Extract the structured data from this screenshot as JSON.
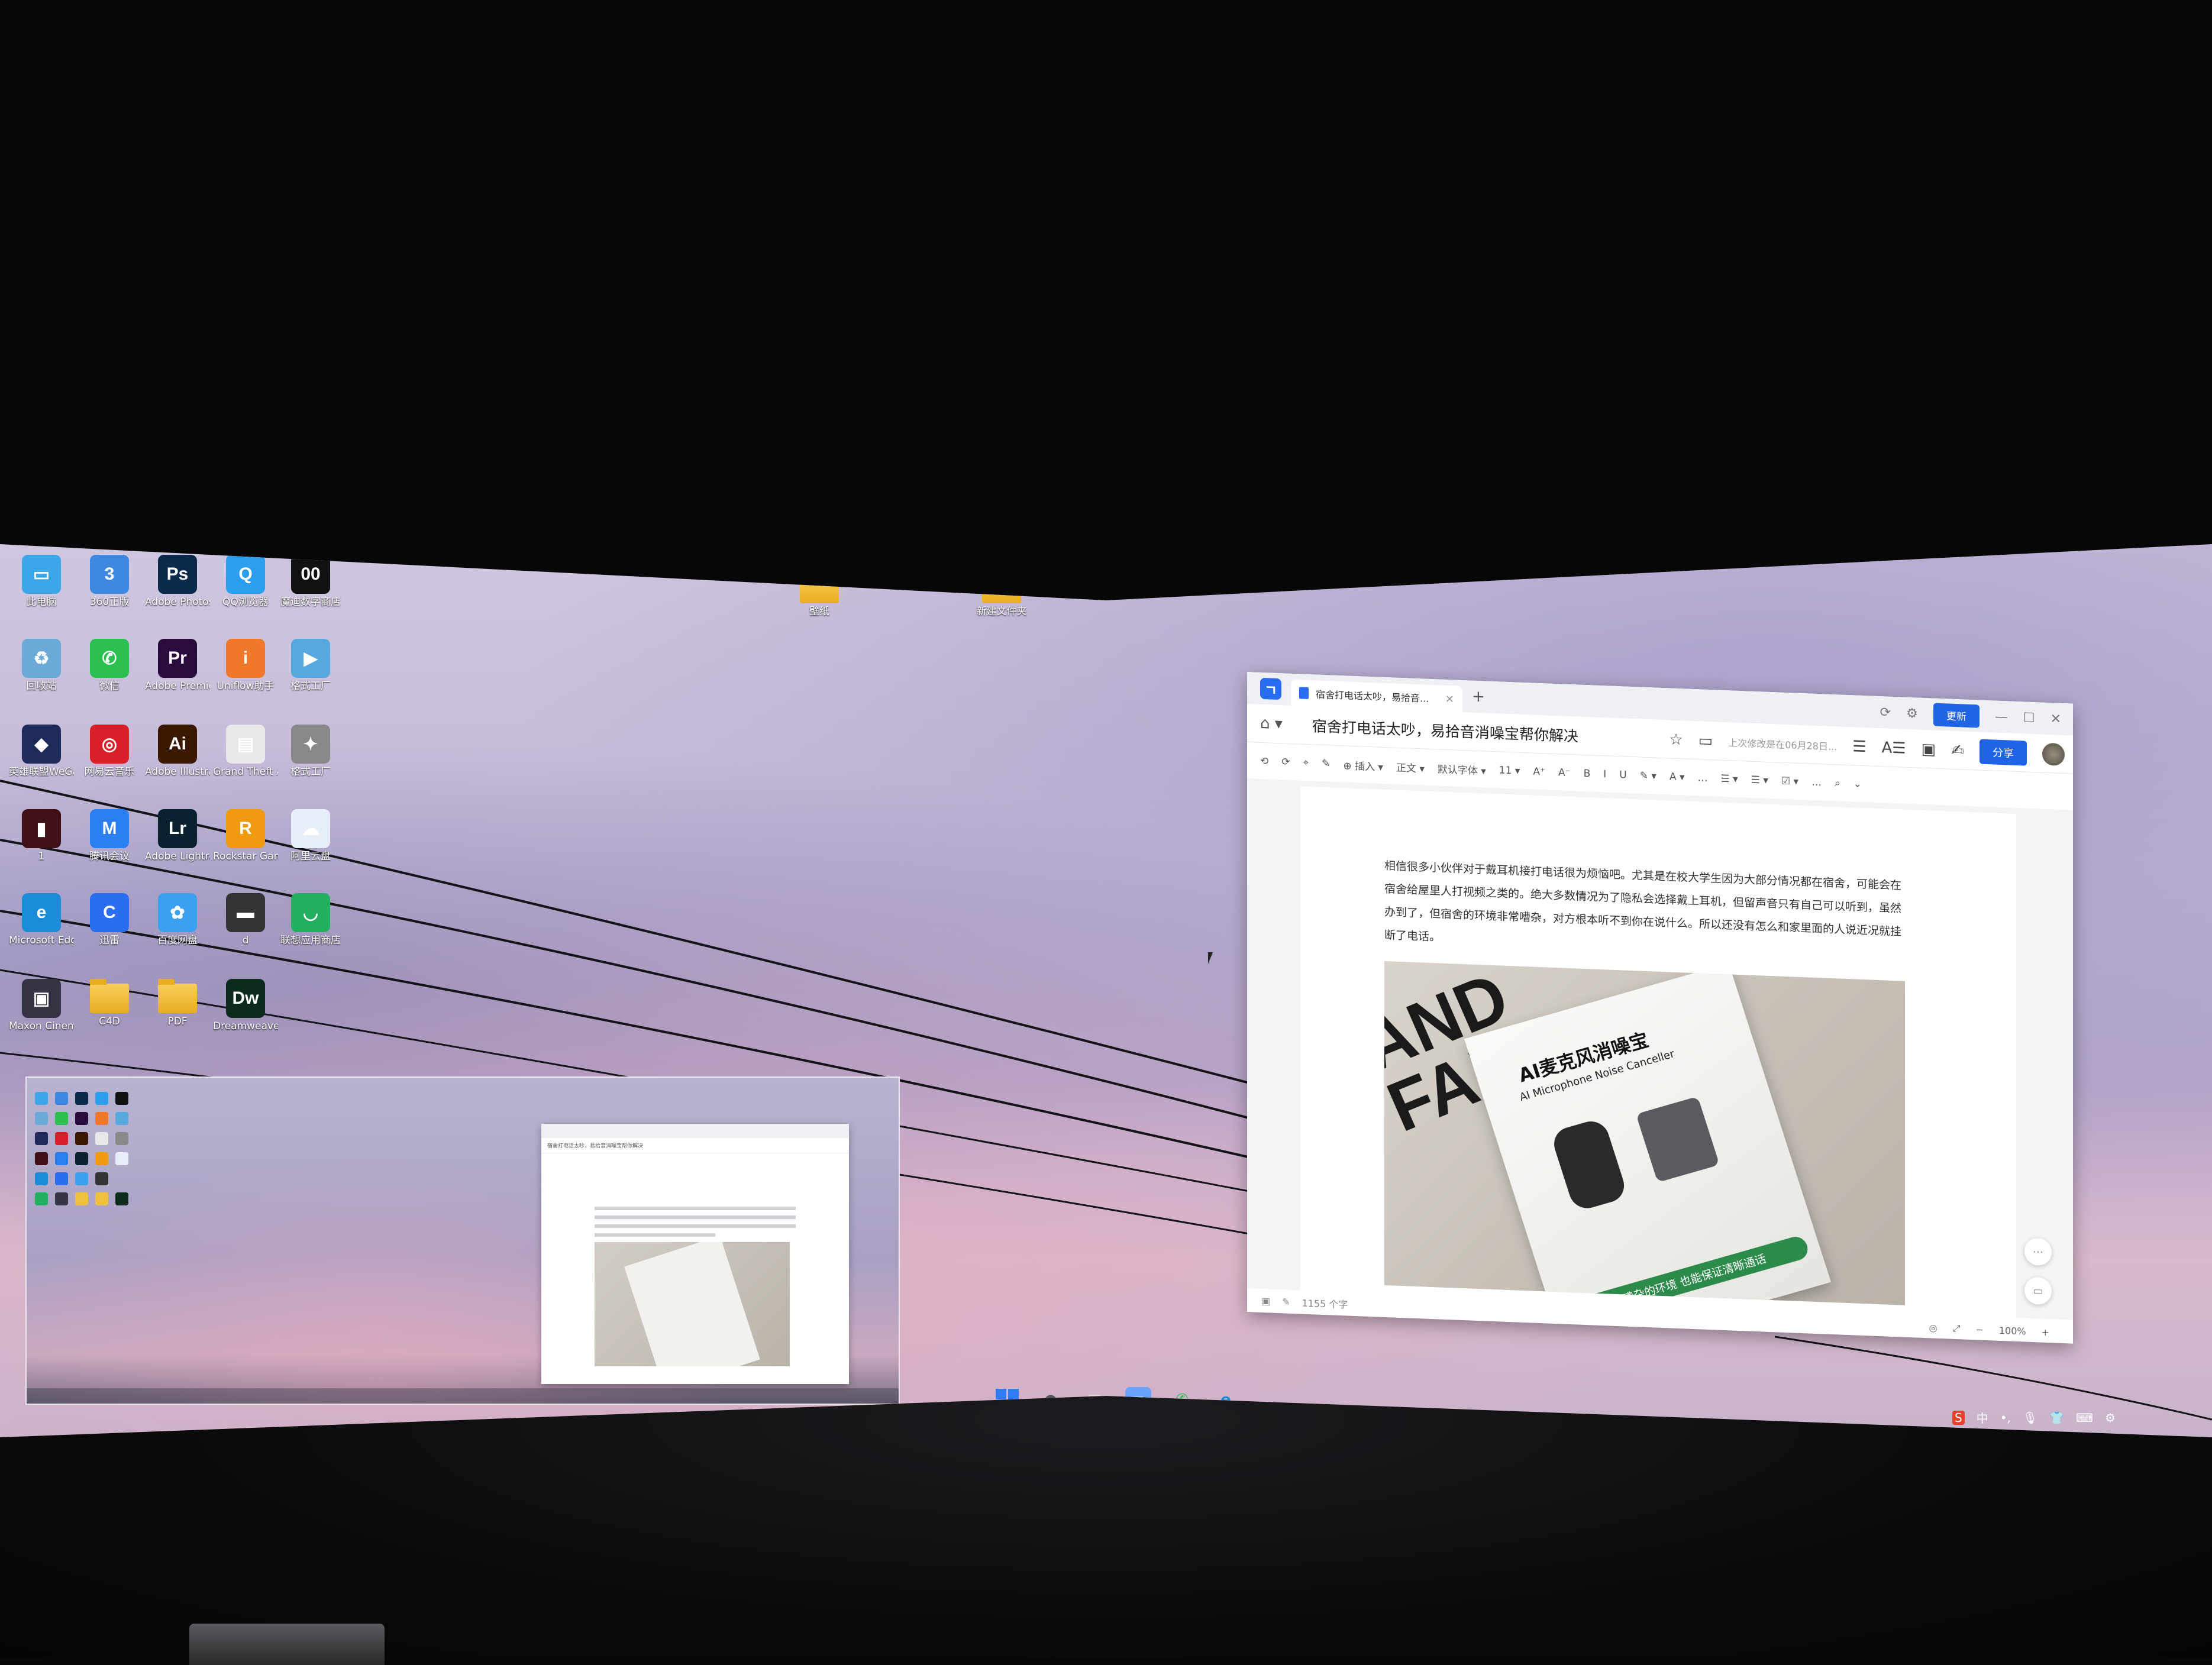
{
  "desktop": {
    "icons": [
      {
        "label": "此电脑",
        "glyph": "▭",
        "color": "#3ba7e8"
      },
      {
        "label": "360正版",
        "glyph": "3",
        "color": "#3e88e0"
      },
      {
        "label": "Adobe Photosh...",
        "glyph": "Ps",
        "color": "#0b2a4a"
      },
      {
        "label": "QQ浏览器",
        "glyph": "Q",
        "color": "#2b9ef0"
      },
      {
        "label": "魔迪数字商店",
        "glyph": "00",
        "color": "#111111"
      },
      {
        "label": "回收站",
        "glyph": "♻",
        "color": "#6aa9d8"
      },
      {
        "label": "微信",
        "glyph": "✆",
        "color": "#2bbf4f"
      },
      {
        "label": "Adobe Premie...",
        "glyph": "Pr",
        "color": "#2a0b3e"
      },
      {
        "label": "Uniflow助手",
        "glyph": "i",
        "color": "#f0782a"
      },
      {
        "label": "格式工厂",
        "glyph": "▶",
        "color": "#58a8e0"
      },
      {
        "label": "英雄联盟WeGame",
        "glyph": "◆",
        "color": "#1e2a5a"
      },
      {
        "label": "网易云音乐",
        "glyph": "◎",
        "color": "#d9202a"
      },
      {
        "label": "Adobe Illustrat...",
        "glyph": "Ai",
        "color": "#3a1800"
      },
      {
        "label": "Grand Theft Auto V",
        "glyph": "▤",
        "color": "#e8e8e8"
      },
      {
        "label": "格式工厂",
        "glyph": "✦",
        "color": "#888888"
      },
      {
        "label": "1",
        "glyph": "▮",
        "color": "#401018"
      },
      {
        "label": "腾讯会议",
        "glyph": "M",
        "color": "#2a7ef0"
      },
      {
        "label": "Adobe Lightroom...",
        "glyph": "Lr",
        "color": "#0a2230"
      },
      {
        "label": "Rockstar Games...",
        "glyph": "R",
        "color": "#f09a10"
      },
      {
        "label": "阿里云盘",
        "glyph": "☁",
        "color": "#e8eef8"
      },
      {
        "label": "Microsoft Edge",
        "glyph": "e",
        "color": "#1a8bd8"
      },
      {
        "label": "迅雷",
        "glyph": "C",
        "color": "#2a6df0"
      },
      {
        "label": "百度网盘",
        "glyph": "✿",
        "color": "#3aa0f0"
      },
      {
        "label": "d",
        "glyph": "▬",
        "color": "#333333"
      },
      {
        "label": "联想应用商店",
        "glyph": "◡",
        "color": "#20b060"
      },
      {
        "label": "Maxon Cinema 4...",
        "glyph": "▣",
        "color": "#333344"
      },
      {
        "label": "C4D",
        "glyph": "",
        "color": "folder"
      },
      {
        "label": "PDF",
        "glyph": "",
        "color": "folder"
      },
      {
        "label": "Dreamweaver 快捷方式",
        "glyph": "Dw",
        "color": "#0a2a1a"
      }
    ],
    "folders": [
      {
        "label": "壁纸"
      },
      {
        "label": "新建文件夹"
      }
    ]
  },
  "wps": {
    "tab_title": "宿舍打电话太吵，易拾音...",
    "tab_close": "×",
    "new_tab": "+",
    "update_label": "更新",
    "doc_title": "宿舍打电话太吵，易拾音消噪宝帮你解决",
    "saved_text": "上次修改是在06月28日...",
    "share_label": "分享",
    "toolbar": [
      "⟲",
      "⟳",
      "⌖",
      "✎",
      "⊕ 插入 ▾",
      "正文 ▾",
      "默认字体 ▾",
      "11 ▾",
      "A⁺",
      "A⁻",
      "B",
      "I",
      "U",
      "✎ ▾",
      "A ▾",
      "…",
      "☰ ▾",
      "☰ ▾",
      "☑ ▾",
      "…",
      "⌕",
      "⌄"
    ],
    "paragraph": "相信很多小伙伴对于戴耳机接打电话很为烦恼吧。尤其是在校大学生因为大部分情况都在宿舍，可能会在宿舍给屋里人打视频之类的。绝大多数情况为了隐私会选择戴上耳机，但留声音只有自己可以听到，虽然办到了，但宿舍的环境非常嘈杂，对方根本听不到你在说什么。所以还没有怎么和家里面的人说近况就挂断了电话。",
    "photo": {
      "big_text": "AND\nFAN",
      "box_title": "AI麦克风消噪宝",
      "box_subtitle": "AI Microphone Noise Canceller",
      "box_band": "再嘈杂的环境 也能保证清晰通话"
    },
    "word_count": "1155 个字",
    "zoom": "100%",
    "zoom_minus": "−",
    "zoom_plus": "+"
  },
  "taskbar": {
    "tray_lang": "中",
    "ime_label": "中"
  }
}
